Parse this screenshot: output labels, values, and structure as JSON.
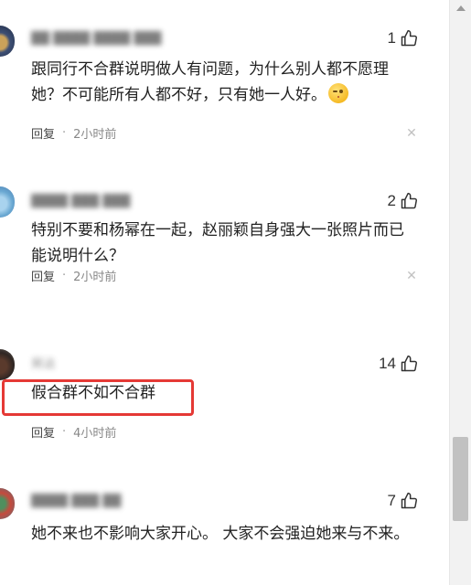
{
  "comments": [
    {
      "username": "██ ████ ████ ███",
      "likes": "1",
      "text": "跟同行不合群说明做人有问题，为什么别人都不愿理她？不可能所有人都不好，只有她一人好。",
      "emoji": "smirk-emoji",
      "reply_label": "回复",
      "separator": "·",
      "time": "2小时前"
    },
    {
      "username": "████ ███ ███",
      "likes": "2",
      "text": "特别不要和杨幂在一起，赵丽颖自身强大一张照片而已能说明什么？",
      "reply_label": "回复",
      "separator": "·",
      "time": "2小时前"
    },
    {
      "username": "另沾",
      "likes": "14",
      "text": "假合群不如不合群",
      "reply_label": "回复",
      "separator": "·",
      "time": "4小时前"
    },
    {
      "username": "████ ███ ██",
      "likes": "7",
      "text": "她不来也不影响大家开心。 大家不会强迫她来与不来。"
    }
  ],
  "colors": {
    "highlight": "#e53935",
    "text": "#222222",
    "meta": "#888888"
  },
  "icons": {
    "like": "thumb-up-icon",
    "dismiss": "close-icon"
  }
}
